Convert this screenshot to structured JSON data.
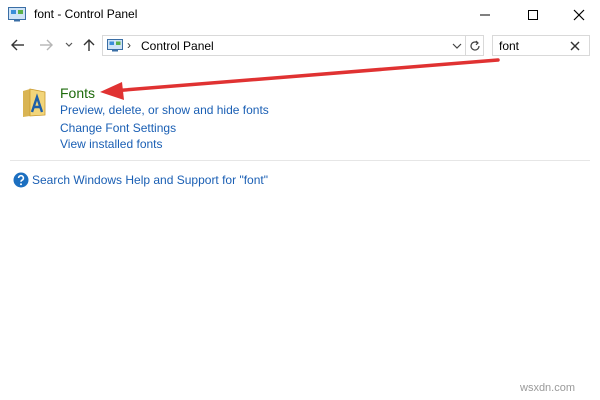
{
  "window": {
    "title": "font - Control Panel"
  },
  "navigation": {
    "breadcrumb_separator": "›",
    "address": "Control Panel",
    "search_value": "font"
  },
  "results": {
    "title": "Fonts",
    "links": [
      "Preview, delete, or show and hide fonts",
      "Change Font Settings",
      "View installed fonts"
    ]
  },
  "help": {
    "link": "Search Windows Help and Support for \"font\""
  },
  "watermark": "wsxdn.com",
  "colors": {
    "result_title": "#1e6b0c",
    "link": "#1a5fb4",
    "arrow": "#e03232"
  }
}
